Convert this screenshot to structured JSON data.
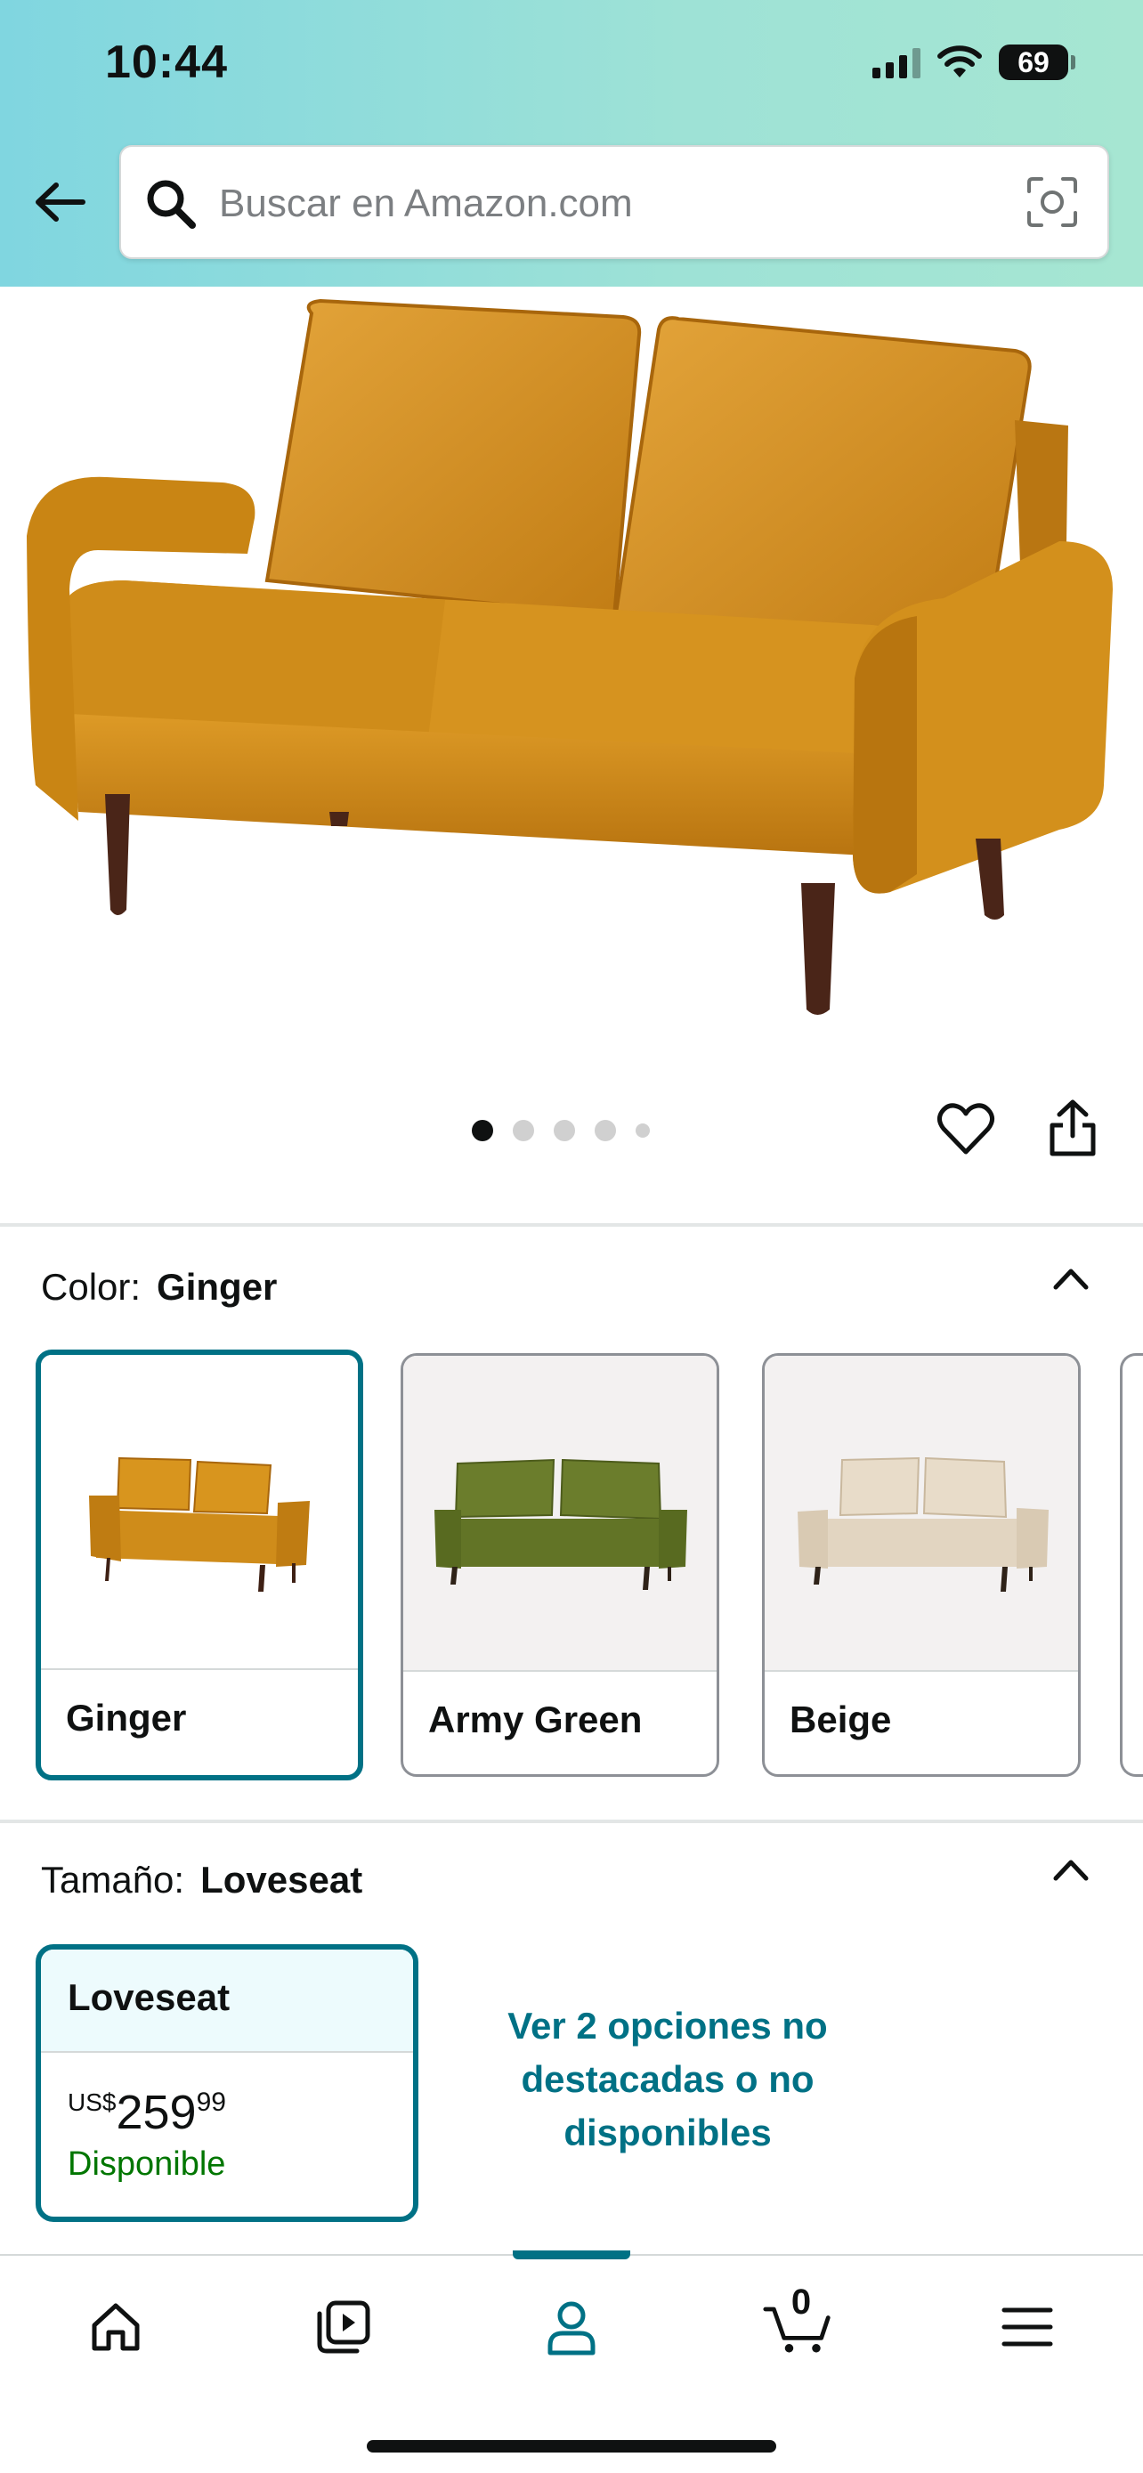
{
  "status_bar": {
    "time": "10:44",
    "battery": "69"
  },
  "search": {
    "placeholder": "Buscar en Amazon.com"
  },
  "gallery": {
    "image_count": 5,
    "active_index": 0
  },
  "color_section": {
    "label": "Color:",
    "selected": "Ginger",
    "options": [
      {
        "name": "Ginger",
        "color": "#d08e1c"
      },
      {
        "name": "Army Green",
        "color": "#6b7d2c"
      },
      {
        "name": "Beige",
        "color": "#e6d9c8"
      }
    ]
  },
  "size_section": {
    "label": "Tamaño:",
    "selected": "Loveseat",
    "card": {
      "name": "Loveseat",
      "currency": "US$",
      "price_whole": "259",
      "price_cents": "99",
      "availability": "Disponible"
    },
    "more_options": "Ver 2 opciones no destacadas o no disponibles"
  },
  "bottom_nav": {
    "cart_count": "0",
    "active": "profile"
  },
  "colors": {
    "accent": "#007185",
    "in_stock": "#007600",
    "product": "#d08e1c"
  }
}
